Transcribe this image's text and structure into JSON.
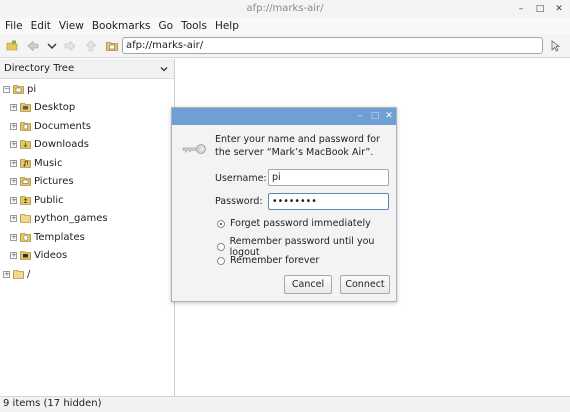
{
  "window": {
    "title": "afp://marks-air/"
  },
  "menus": [
    "File",
    "Edit",
    "View",
    "Bookmarks",
    "Go",
    "Tools",
    "Help"
  ],
  "toolbar": {
    "address": "afp://marks-air/"
  },
  "sidebar": {
    "header": "Directory Tree",
    "root": {
      "label": "pi",
      "expander": "−"
    },
    "items": [
      {
        "label": "Desktop",
        "expander": "+"
      },
      {
        "label": "Documents",
        "expander": "+"
      },
      {
        "label": "Downloads",
        "expander": "+"
      },
      {
        "label": "Music",
        "expander": "+"
      },
      {
        "label": "Pictures",
        "expander": "+"
      },
      {
        "label": "Public",
        "expander": "+"
      },
      {
        "label": "python_games",
        "expander": "+"
      },
      {
        "label": "Templates",
        "expander": "+"
      },
      {
        "label": "Videos",
        "expander": "+"
      }
    ],
    "fs_root": {
      "label": "/",
      "expander": "+"
    }
  },
  "status": {
    "text": "9 items (17 hidden)"
  },
  "dialog": {
    "message": "Enter your name and password for the server “Mark’s MacBook Air”.",
    "username_label": "Username:",
    "username_value": "pi",
    "password_label": "Password:",
    "password_value": "••••••••",
    "options": [
      {
        "label": "Forget password immediately",
        "selected": true
      },
      {
        "label": "Remember password until you logout",
        "selected": false
      },
      {
        "label": "Remember forever",
        "selected": false
      }
    ],
    "cancel_label": "Cancel",
    "connect_label": "Connect"
  },
  "colors": {
    "dialog_titlebar": "#6f9fd4",
    "folder_yellow": "#e8c760",
    "window_bg": "#f4f4f4"
  }
}
